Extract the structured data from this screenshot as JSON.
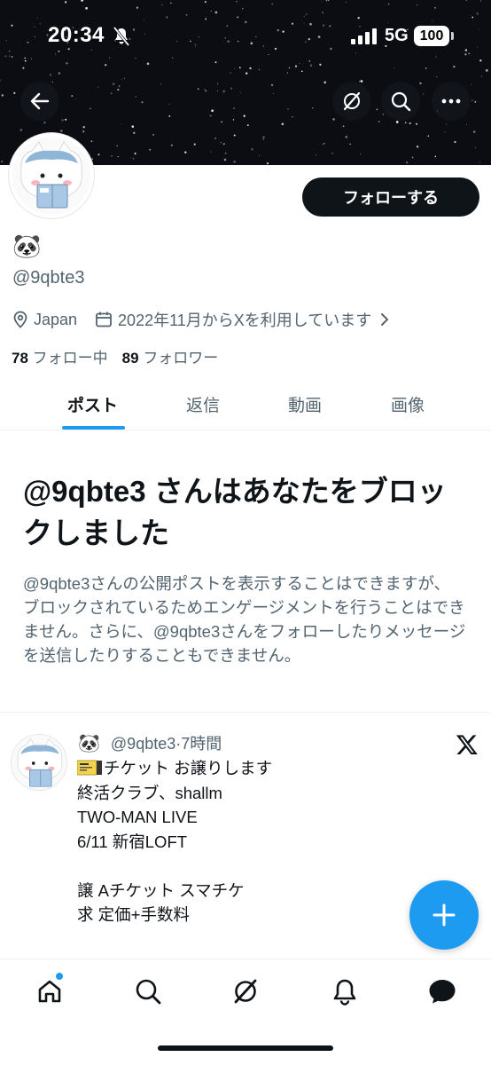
{
  "status_bar": {
    "time": "20:34",
    "network": "5G",
    "battery": "100"
  },
  "header_buttons": [
    "back-icon",
    "grok-icon",
    "search-icon",
    "more-icon"
  ],
  "profile": {
    "display_name": "🐼",
    "handle": "@9qbte3",
    "location": "Japan",
    "joined": "2022年11月からXを利用しています",
    "following_count": "78",
    "following_label": "フォロー中",
    "followers_count": "89",
    "followers_label": "フォロワー",
    "follow_button": "フォローする"
  },
  "tabs": [
    {
      "label": "ポスト",
      "active": true
    },
    {
      "label": "返信",
      "active": false
    },
    {
      "label": "動画",
      "active": false
    },
    {
      "label": "画像",
      "active": false
    }
  ],
  "blocked": {
    "title": "@9qbte3 さんはあなたをブロックしました",
    "description": "@9qbte3さんの公開ポストを表示することはできますが、ブロックされているためエンゲージメントを行うことはできません。さらに、@9qbte3さんをフォローしたりメッセージを送信したりすることもできません。"
  },
  "post": {
    "emoji": "🐼",
    "handle_time": "@9qbte3·7時間",
    "first_line": "チケット お譲りします",
    "body": "\n終活クラブ、shallm\nTWO-MAN LIVE\n6/11 新宿LOFT\n\n譲  Aチケット スマチケ\n求  定価+手数料"
  },
  "fab_icon": "plus-icon",
  "bottom_nav": [
    "home-icon",
    "search-icon",
    "grok-icon",
    "bell-icon",
    "messages-icon"
  ],
  "colors": {
    "accent": "#1d9bf0",
    "text": "#0f1419",
    "muted": "#536471"
  }
}
